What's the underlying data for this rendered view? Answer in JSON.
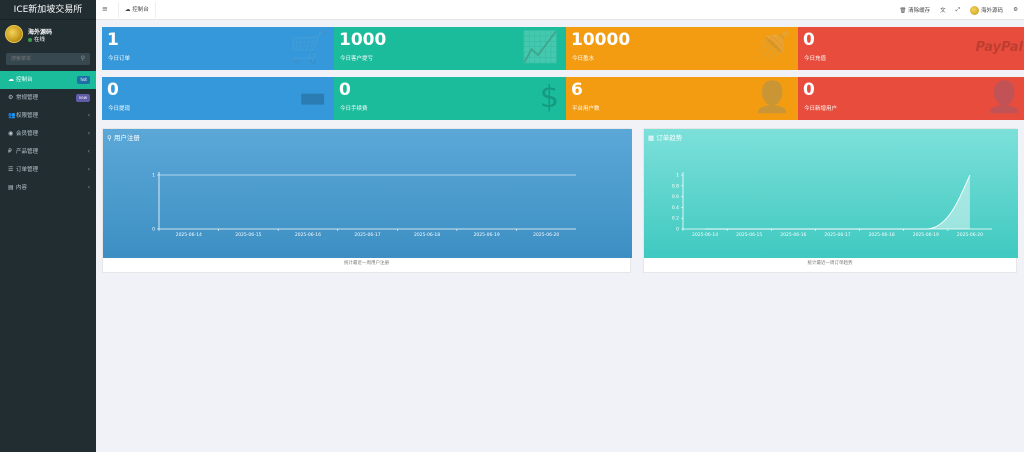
{
  "sidebar": {
    "brand": "ICE新加坡交易所",
    "user_name": "海外源码",
    "user_status": "在线",
    "search_placeholder": "搜索菜单",
    "items": [
      {
        "icon": "dashboard-icon",
        "glyph": "☁",
        "label": "控制台",
        "badge": "hot",
        "badge_color": "#1d6fa5"
      },
      {
        "icon": "gears-icon",
        "glyph": "⚙",
        "label": "常规管理",
        "badge": "new",
        "badge_color": "#605ca8"
      },
      {
        "icon": "group-icon",
        "glyph": "👥",
        "label": "权限管理"
      },
      {
        "icon": "user-circle-icon",
        "glyph": "◉",
        "label": "会员管理"
      },
      {
        "icon": "product-icon",
        "glyph": "₽",
        "label": "产品管理"
      },
      {
        "icon": "list-icon",
        "glyph": "☰",
        "label": "订单管理"
      },
      {
        "icon": "list-alt-icon",
        "glyph": "▤",
        "label": "内容"
      }
    ]
  },
  "topbar": {
    "tab_label": "控制台",
    "clear_cache": "清除缓存",
    "user_name": "海外源码"
  },
  "stats": [
    {
      "value": "1",
      "label": "今日订单",
      "color": "blue",
      "icon": "cart-icon",
      "glyph": "🛒"
    },
    {
      "value": "1000",
      "label": "今日客户提亏",
      "color": "green",
      "icon": "area-chart-icon",
      "glyph": "📈"
    },
    {
      "value": "10000",
      "label": "今日盈水",
      "color": "orange",
      "icon": "shower-icon",
      "glyph": "🚿"
    },
    {
      "value": "0",
      "label": "今日充值",
      "color": "red",
      "icon": "paypal-icon",
      "glyph": "PayPal"
    },
    {
      "value": "0",
      "label": "今日提现",
      "color": "blue",
      "icon": "credit-card-icon",
      "glyph": "▬"
    },
    {
      "value": "0",
      "label": "今日手续费",
      "color": "green",
      "icon": "dollar-icon",
      "glyph": "$"
    },
    {
      "value": "6",
      "label": "平台用户数",
      "color": "orange",
      "icon": "user-icon",
      "glyph": "👤"
    },
    {
      "value": "0",
      "label": "今日新增用户",
      "color": "red",
      "icon": "user-outline-icon",
      "glyph": "👤"
    }
  ],
  "charts": [
    {
      "title": "用户注册",
      "icon": "map-marker-icon",
      "glyph": "⚲",
      "footer": "统计最近一周用户注册"
    },
    {
      "title": "订单趋势",
      "icon": "table-icon",
      "glyph": "▦",
      "footer": "统计最近一周订单趋势"
    }
  ],
  "chart_data": [
    {
      "type": "line",
      "title": "用户注册",
      "x": [
        "2025-06-14",
        "2025-06-15",
        "2025-06-16",
        "2025-06-17",
        "2025-06-18",
        "2025-06-19",
        "2025-06-20"
      ],
      "series": [
        {
          "values": [
            1,
            1,
            1,
            1,
            1,
            1,
            1
          ]
        }
      ],
      "ylim": [
        0,
        1
      ],
      "yticks": [
        0,
        1
      ],
      "gradient": [
        "#5ba8d8",
        "#3d8fc3"
      ]
    },
    {
      "type": "area",
      "title": "订单趋势",
      "x": [
        "2025-06-14",
        "2025-06-15",
        "2025-06-16",
        "2025-06-17",
        "2025-06-18",
        "2025-06-19",
        "2025-06-20"
      ],
      "series": [
        {
          "values": [
            0,
            0,
            0,
            0,
            0,
            0,
            1
          ]
        }
      ],
      "ylim": [
        0,
        1
      ],
      "yticks": [
        0,
        0.2,
        0.4,
        0.6,
        0.8,
        1
      ],
      "gradient": [
        "#7de0da",
        "#3fc9c0"
      ]
    }
  ]
}
